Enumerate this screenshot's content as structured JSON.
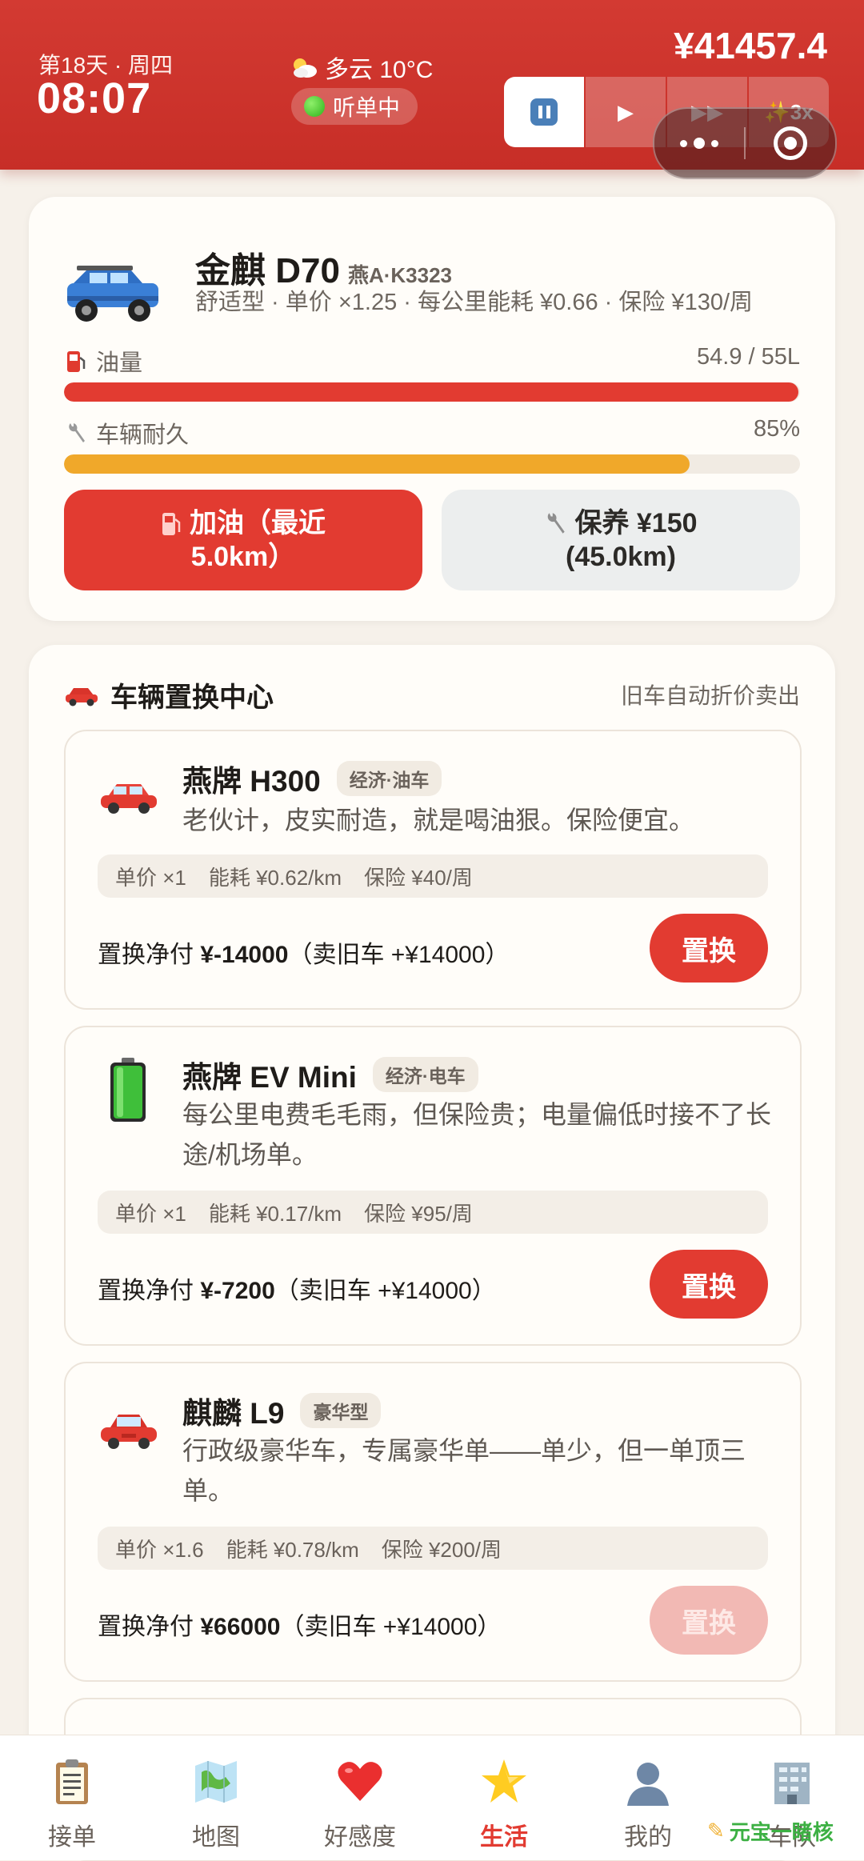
{
  "status": {
    "day": "第18天 · 周四",
    "time": "08:07",
    "weather": "多云 10°C",
    "listening": "听单中",
    "money": "¥41457.4",
    "speed_max": "3x"
  },
  "vehicle": {
    "name": "金麒 D70",
    "plate": "燕A·K3323",
    "spec": "舒适型 · 单价 ×1.25 · 每公里能耗 ¥0.66 · 保险 ¥130/周",
    "fuel_label": "油量",
    "fuel_value": "54.9 / 55L",
    "fuel_fraction": 0.998,
    "durability_label": "车辆耐久",
    "durability_value": "85%",
    "durability_fraction": 0.85,
    "refuel_button": [
      "加油（最近",
      "5.0km）"
    ],
    "service_button": [
      "保养 ¥150",
      "(45.0km)"
    ]
  },
  "swap_center": {
    "title": "车辆置换中心",
    "note": "旧车自动折价卖出",
    "offers": [
      {
        "name": "燕牌 H300",
        "tag": "经济·油车",
        "desc": "老伙计，皮实耐造，就是喝油狠。保险便宜。",
        "price_mult": "单价 ×1",
        "energy": "能耗 ¥0.62/km",
        "insurance": "保险 ¥40/周",
        "net_prefix": "置换净付 ",
        "net_amount": "¥-14000",
        "net_suffix": "（卖旧车 +¥14000）",
        "button": "置换",
        "enabled": true
      },
      {
        "name": "燕牌 EV Mini",
        "tag": "经济·电车",
        "desc": "每公里电费毛毛雨，但保险贵；电量偏低时接不了长途/机场单。",
        "price_mult": "单价 ×1",
        "energy": "能耗 ¥0.17/km",
        "insurance": "保险 ¥95/周",
        "net_prefix": "置换净付 ",
        "net_amount": "¥-7200",
        "net_suffix": "（卖旧车 +¥14000）",
        "button": "置换",
        "enabled": true
      },
      {
        "name": "麒麟 L9",
        "tag": "豪华型",
        "desc": "行政级豪华车，专属豪华单——单少，但一单顶三单。",
        "price_mult": "单价 ×1.6",
        "energy": "能耗 ¥0.78/km",
        "insurance": "保险 ¥200/周",
        "net_prefix": "置换净付 ",
        "net_amount": "¥66000",
        "net_suffix": "（卖旧车 +¥14000）",
        "button": "置换",
        "enabled": false
      }
    ]
  },
  "nav": {
    "items": [
      {
        "label": "接单",
        "icon": "clipboard-icon"
      },
      {
        "label": "地图",
        "icon": "map-icon"
      },
      {
        "label": "好感度",
        "icon": "heart-icon"
      },
      {
        "label": "生活",
        "icon": "star-icon"
      },
      {
        "label": "我的",
        "icon": "user-icon"
      },
      {
        "label": "车队",
        "icon": "building-icon"
      }
    ],
    "active_index": 3
  },
  "watermark": "元宝一睹核",
  "colors": {
    "header": "#d33a32",
    "accent": "#e23b31",
    "fuel_bar": "#e23b31",
    "durability_bar": "#f0a82a"
  }
}
